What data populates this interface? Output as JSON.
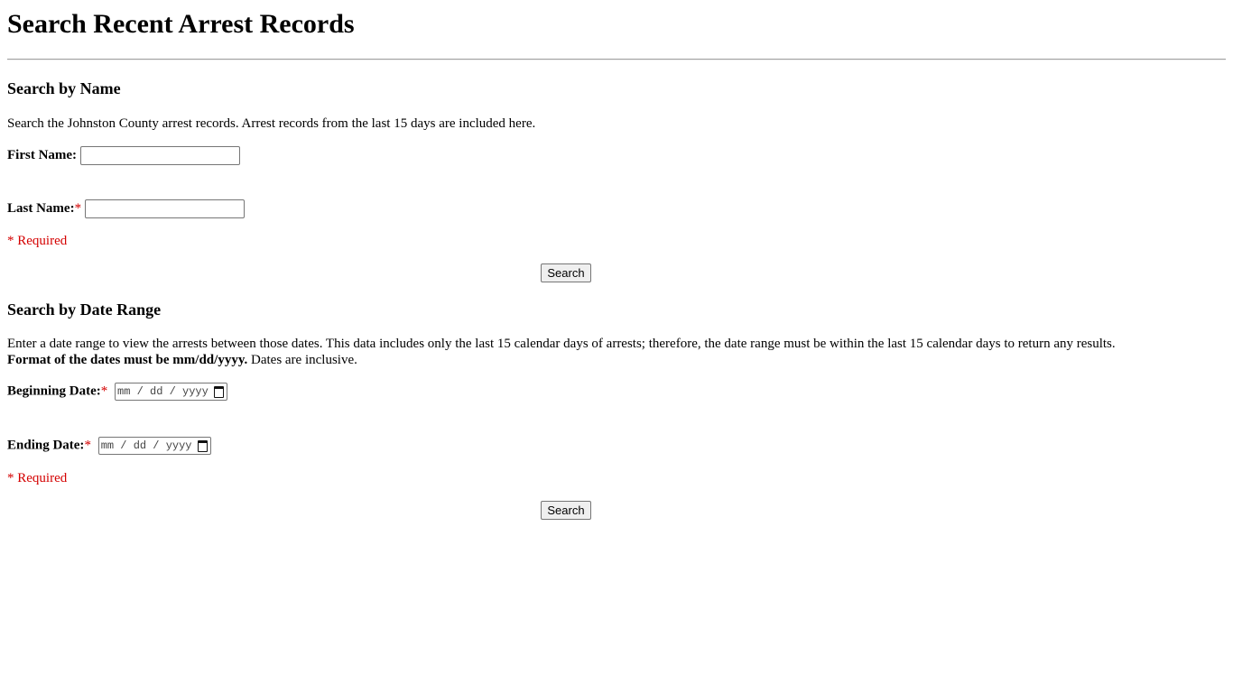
{
  "page": {
    "title": "Search Recent Arrest Records"
  },
  "name_search": {
    "heading": "Search by Name",
    "description": "Search the Johnston County arrest records. Arrest records from the last 15 days are included here.",
    "first_name_label": "First Name:",
    "first_name_value": "",
    "last_name_label": "Last Name:",
    "last_name_value": "",
    "required_star": "*",
    "required_note": "* Required",
    "search_button": "Search"
  },
  "date_search": {
    "heading": "Search by Date Range",
    "description": "Enter a date range to view the arrests between those dates. This data includes only the last 15 calendar days of arrests; therefore, the date range must be within the last 15 calendar days to return any results.",
    "format_note_bold": "Format of the dates must be mm/dd/yyyy.",
    "format_note_rest": " Dates are inclusive.",
    "beginning_date_label": "Beginning Date:",
    "beginning_date_placeholder": "mm / dd / yyyy",
    "ending_date_label": "Ending Date:",
    "ending_date_placeholder": "mm / dd / yyyy",
    "required_star": "*",
    "required_note": "* Required",
    "search_button": "Search",
    "calendar_icon": "calendar-icon"
  },
  "colors": {
    "required": "#d40000",
    "rule": "#a0a0a0"
  }
}
